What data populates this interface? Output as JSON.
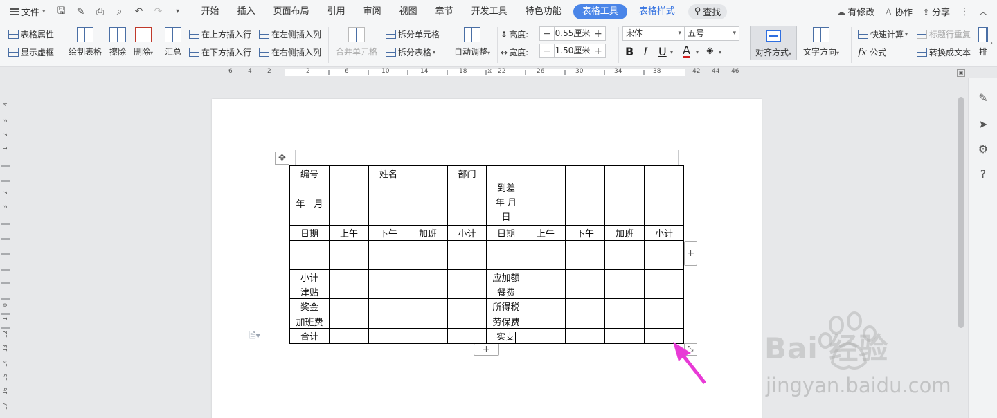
{
  "menubar": {
    "file_label": "文件",
    "tabs": [
      "开始",
      "插入",
      "页面布局",
      "引用",
      "审阅",
      "视图",
      "章节",
      "开发工具",
      "特色功能"
    ],
    "active_tab": "表格工具",
    "secondary_tab": "表格样式",
    "search_label": "查找",
    "right": {
      "changes": "有修改",
      "collab": "协作",
      "share": "分享"
    }
  },
  "ribbon": {
    "table_props": "表格属性",
    "show_gridlines": "显示虚框",
    "draw_table": "绘制表格",
    "erase": "擦除",
    "delete": "删除",
    "summary": "汇总",
    "insert_above": "在上方插入行",
    "insert_below": "在下方插入行",
    "insert_left": "在左侧插入列",
    "insert_right": "在右侧插入列",
    "merge_cells": "合并单元格",
    "split_cells": "拆分单元格",
    "split_table": "拆分表格",
    "auto_fit": "自动调整",
    "height_label": "高度:",
    "height_value": "0.55厘米",
    "width_label": "宽度:",
    "width_value": "1.50厘米",
    "font_name": "宋体",
    "font_size": "五号",
    "align": "对齐方式",
    "text_direction": "文字方向",
    "quick_calc": "快速计算",
    "repeat_header": "标题行重复",
    "formula": "公式",
    "convert_text": "转换成文本",
    "sort_partial": "排"
  },
  "ruler": {
    "h_ticks": [
      "6",
      "4",
      "2",
      "2",
      "6",
      "10",
      "14",
      "18",
      "22",
      "26",
      "30",
      "34",
      "38",
      "42",
      "44",
      "46"
    ],
    "v_ticks": [
      "4",
      "3",
      "2",
      "1",
      "2",
      "3",
      "0",
      "1",
      "12",
      "13",
      "14",
      "15",
      "16",
      "17"
    ]
  },
  "table": {
    "header_row": [
      "编号",
      "",
      "姓名",
      "",
      "部门",
      "",
      "",
      "",
      "",
      ""
    ],
    "date_row": [
      "年　月",
      "",
      "",
      "",
      "",
      "到差\n年 月\n日",
      "",
      "",
      "",
      ""
    ],
    "column_headers": [
      "日期",
      "上午",
      "下午",
      "加班",
      "小计",
      "日期",
      "上午",
      "下午",
      "加班",
      "小计"
    ],
    "empty_rows": 2,
    "summary_rows": [
      [
        "小计",
        "应加额"
      ],
      [
        "津贴",
        "餐费"
      ],
      [
        "奖金",
        "所得税"
      ],
      [
        "加班费",
        "劳保费"
      ],
      [
        "合计",
        "实支"
      ]
    ]
  },
  "watermark": {
    "brand": "Bai  经验",
    "url": "jingyan.baidu.com"
  },
  "colors": {
    "accent": "#4a85e8",
    "arrow": "#e83ad6",
    "tab_blue": "#2f6fe0"
  }
}
